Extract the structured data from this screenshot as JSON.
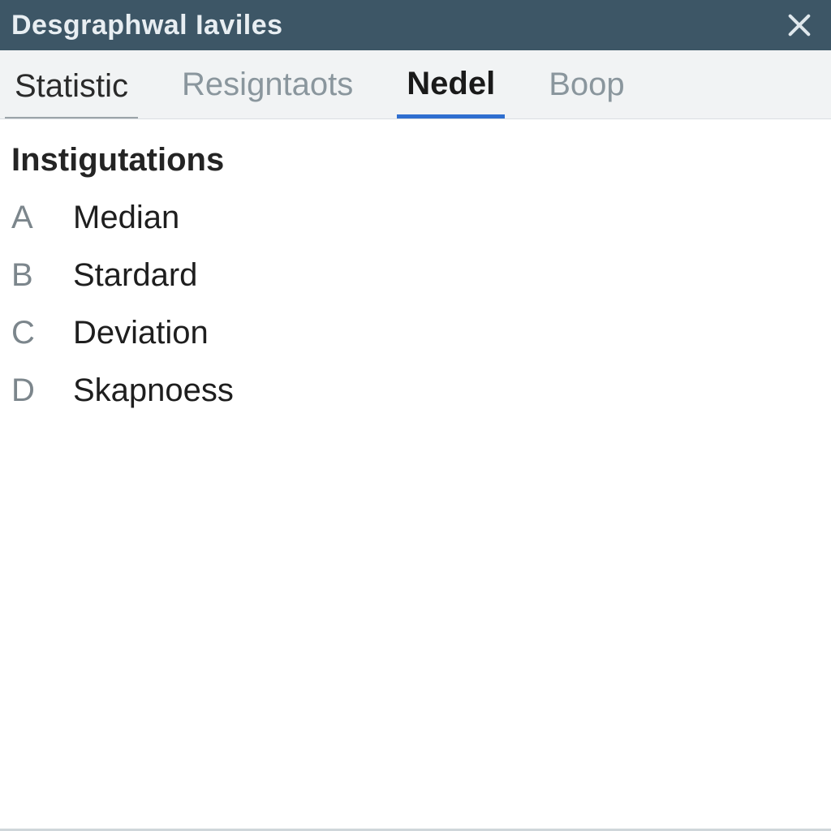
{
  "titlebar": {
    "title": "Desgraphwal Iaviles"
  },
  "tabs": [
    {
      "label": "Statistic",
      "state": "primary"
    },
    {
      "label": "Resigntaots",
      "state": "normal"
    },
    {
      "label": "Nedel",
      "state": "selected"
    },
    {
      "label": "Boop",
      "state": "normal"
    }
  ],
  "section": {
    "title": "Instigutations",
    "options": [
      {
        "letter": "A",
        "label": "Median"
      },
      {
        "letter": "B",
        "label": "Stardard"
      },
      {
        "letter": "C",
        "label": "Deviation"
      },
      {
        "letter": "D",
        "label": "Skapnoess"
      }
    ]
  }
}
